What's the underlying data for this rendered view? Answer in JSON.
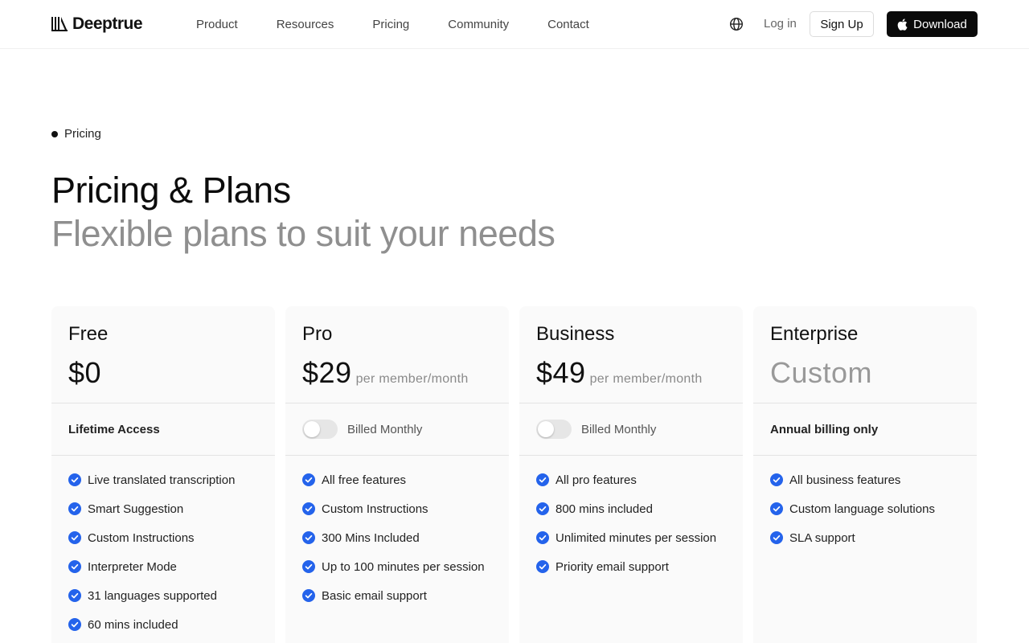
{
  "header": {
    "logo_text": "Deeptrue",
    "nav": [
      "Product",
      "Resources",
      "Pricing",
      "Community",
      "Contact"
    ],
    "login_label": "Log in",
    "signup_label": "Sign Up",
    "download_label": "Download",
    "icons": {
      "logo": "logo-icon",
      "language": "globe-icon",
      "download": "apple-icon"
    }
  },
  "hero": {
    "eyebrow": "Pricing",
    "title": "Pricing & Plans",
    "subtitle": "Flexible plans to suit your needs"
  },
  "plans": [
    {
      "name": "Free",
      "price": "$0",
      "per": "",
      "billing": "Lifetime Access",
      "features": [
        "Live translated transcription",
        "Smart Suggestion",
        "Custom Instructions",
        "Interpreter Mode",
        "31 languages supported",
        "60 mins included"
      ]
    },
    {
      "name": "Pro",
      "price": "$29",
      "per": "per member/month",
      "billing": "Billed Monthly",
      "toggle_on": false,
      "features": [
        "All free features",
        "Custom Instructions",
        "300 Mins Included",
        "Up to 100 minutes per session",
        "Basic email support"
      ]
    },
    {
      "name": "Business",
      "price": "$49",
      "per": "per member/month",
      "billing": "Billed Monthly",
      "toggle_on": false,
      "features": [
        "All pro features",
        "800 mins included",
        "Unlimited minutes per session",
        "Priority email support"
      ]
    },
    {
      "name": "Enterprise",
      "price": "Custom",
      "per": "",
      "billing": "Annual billing only",
      "features": [
        "All business features",
        "Custom language solutions",
        "SLA support"
      ]
    }
  ],
  "colors": {
    "accent": "#2463eb",
    "text": "#111111",
    "muted": "#8f8f8f",
    "card": "#fafafa"
  }
}
